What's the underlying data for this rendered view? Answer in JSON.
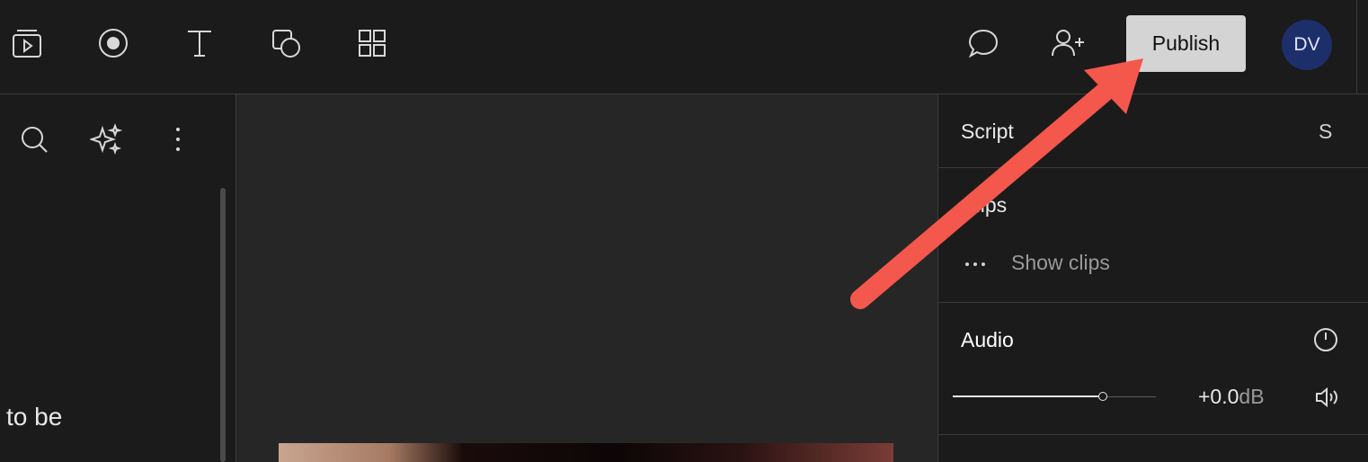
{
  "toolbar": {
    "icons": [
      "media-icon",
      "record-icon",
      "text-icon",
      "shapes-icon",
      "grid-icon"
    ],
    "comment_icon": "comment-icon",
    "share_icon": "add-user-icon",
    "publish_label": "Publish",
    "avatar_initials": "DV"
  },
  "left_panel": {
    "icons": [
      "search-icon",
      "sparkle-icon",
      "more-vertical-icon"
    ],
    "partial_text": "to be"
  },
  "right_panel": {
    "script_label": "Script",
    "script_shortcut": "S",
    "clips_label": "Clips",
    "show_clips_label": "Show clips",
    "audio_label": "Audio",
    "audio_value": "+0.0",
    "audio_unit": "dB",
    "audio_level": 0.74
  },
  "annotation": {
    "arrow_color": "#f4574b"
  },
  "colors": {
    "background": "#1b1b1b",
    "canvas": "#262626",
    "publish_button": "#d4d4d4",
    "avatar": "#1d2f6b"
  }
}
